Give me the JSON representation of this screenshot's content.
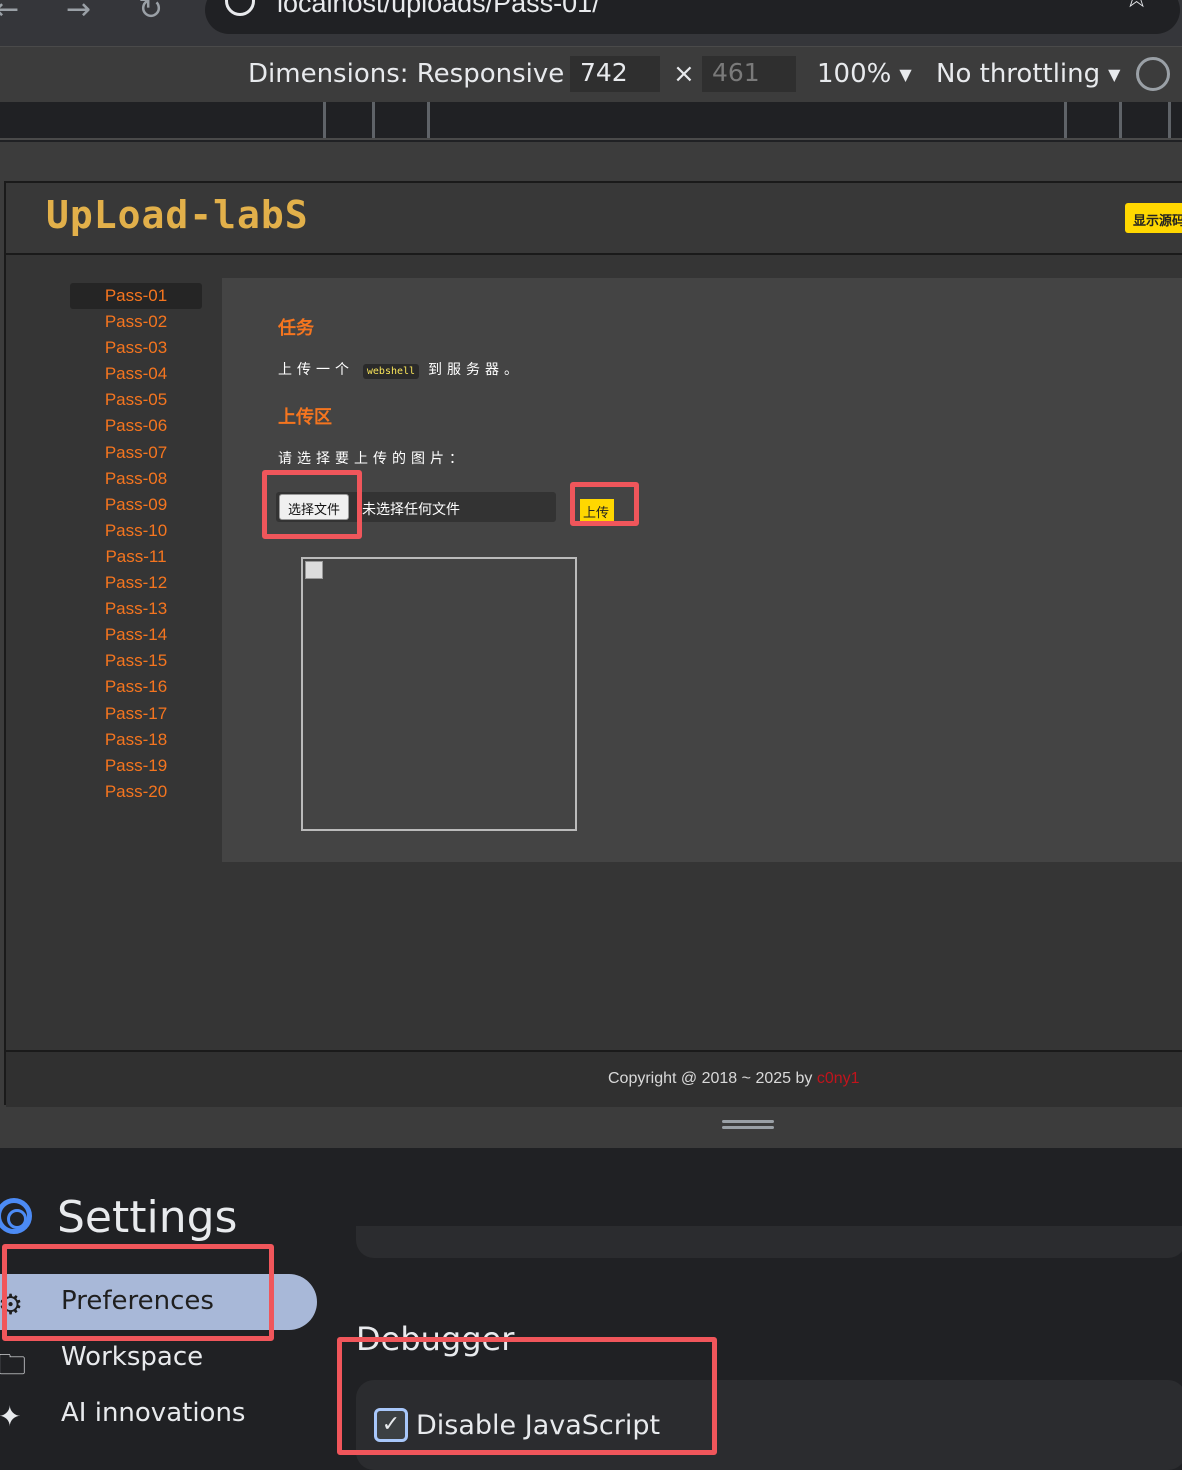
{
  "browser": {
    "url": "localhost/uploads/Pass-01/",
    "back_icon": "arrow-left-icon",
    "forward_icon": "arrow-right-icon",
    "reload_icon": "reload-icon",
    "bookmark_icon": "star-icon"
  },
  "device_toolbar": {
    "dimensions_label": "Dimensions: Responsive",
    "width": "742",
    "times": "×",
    "height": "461",
    "zoom": "100%",
    "throttling": "No throttling"
  },
  "site": {
    "logo": "UpLoad-labS",
    "show_source_button": "显示源码",
    "nav": [
      "Pass-01",
      "Pass-02",
      "Pass-03",
      "Pass-04",
      "Pass-05",
      "Pass-06",
      "Pass-07",
      "Pass-08",
      "Pass-09",
      "Pass-10",
      "Pass-11",
      "Pass-12",
      "Pass-13",
      "Pass-14",
      "Pass-15",
      "Pass-16",
      "Pass-17",
      "Pass-18",
      "Pass-19",
      "Pass-20"
    ],
    "active_nav": "Pass-01",
    "task_heading": "任务",
    "task_prefix": "上传一个",
    "task_code": "webshell",
    "task_suffix": "到服务器。",
    "upload_heading": "上传区",
    "choose_prompt": "请选择要上传的图片：",
    "choose_file_button": "选择文件",
    "no_file_text": "未选择任何文件",
    "upload_button": "上传",
    "footer_text": "Copyright @ 2018 ~ 2025 by ",
    "footer_author": "c0ny1"
  },
  "settings": {
    "title": "Settings",
    "sidebar": [
      {
        "label": "Preferences",
        "icon": "gear-icon",
        "active": true
      },
      {
        "label": "Workspace",
        "icon": "folder-icon",
        "active": false
      },
      {
        "label": "AI innovations",
        "icon": "sparkle-icon",
        "active": false
      }
    ],
    "section_title": "Debugger",
    "disable_js_label": "Disable JavaScript",
    "disable_js_checked": true
  },
  "colors": {
    "accent_orange": "#f5751f",
    "highlight_red": "#f0565b",
    "button_yellow": "#ffd700",
    "author_red": "#c0141c"
  }
}
